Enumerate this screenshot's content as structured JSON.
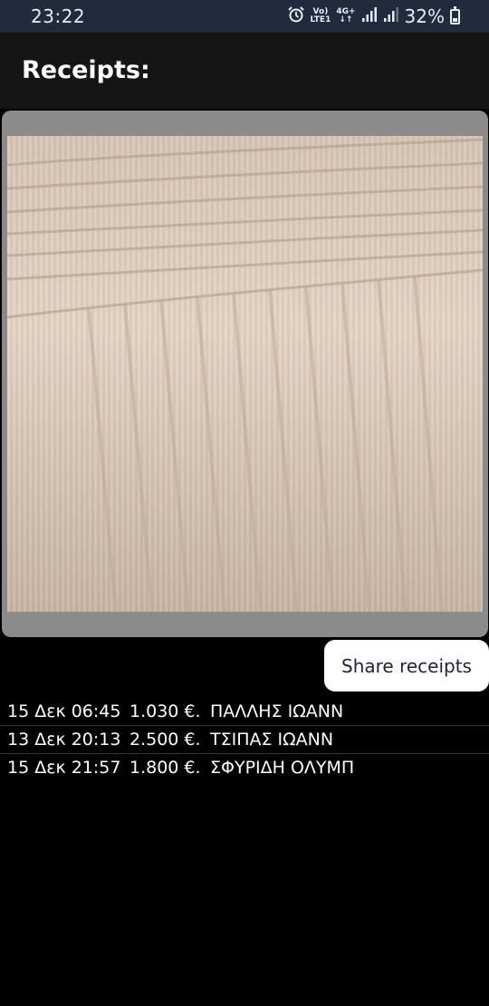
{
  "statusbar": {
    "time": "23:22",
    "network_top": "Vo)",
    "network_bottom": "LTE1",
    "data_top": "4G+",
    "data_bottom": "↓↑",
    "battery": "32%"
  },
  "appbar": {
    "title": "Receipts:"
  },
  "share_button": {
    "label": "Share receipts"
  },
  "receipts": [
    {
      "date": "15 Δεκ 06:45",
      "amount": "1.030 €.",
      "name": "ΠΑΛΛΗΣ ΙΩΑΝΝ"
    },
    {
      "date": "13 Δεκ 20:13",
      "amount": "2.500 €.",
      "name": "ΤΣΙΠΑΣ ΙΩΑΝΝ"
    },
    {
      "date": "15 Δεκ 21:57",
      "amount": "1.800 €.",
      "name": "ΣΦΥΡΙΔΗ ΟΛΥΜΠ"
    }
  ],
  "icons": {
    "alarm": "alarm-icon",
    "signal": "signal-icon",
    "battery": "battery-icon"
  }
}
